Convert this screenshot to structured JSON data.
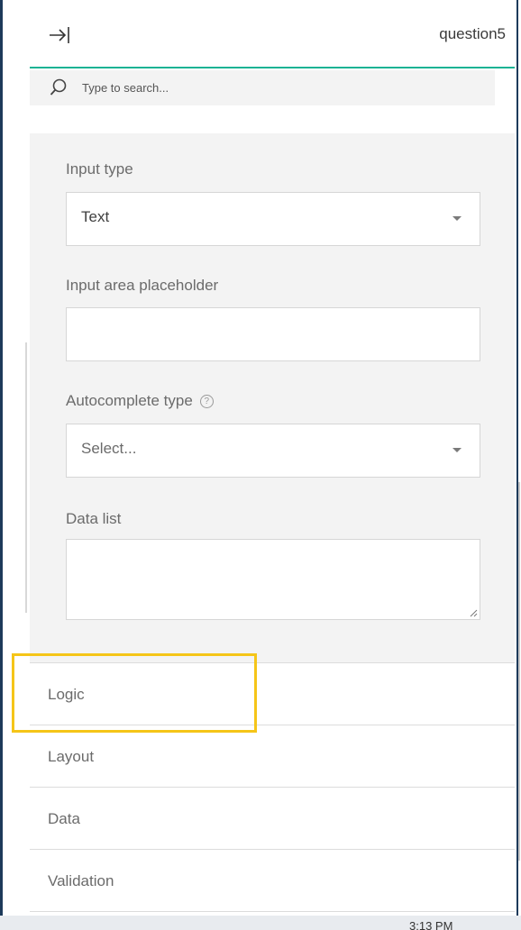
{
  "header": {
    "title": "question5",
    "collapse_icon": "collapse-to-right-icon"
  },
  "search": {
    "placeholder": "Type to search...",
    "icon": "search-icon"
  },
  "properties": {
    "input_type": {
      "label": "Input type",
      "value": "Text"
    },
    "placeholder_field": {
      "label": "Input area placeholder",
      "value": ""
    },
    "autocomplete": {
      "label": "Autocomplete type",
      "value": "Select...",
      "help_icon": "?"
    },
    "data_list": {
      "label": "Data list",
      "value": ""
    }
  },
  "sections": [
    {
      "label": "Logic",
      "highlighted": true
    },
    {
      "label": "Layout"
    },
    {
      "label": "Data"
    },
    {
      "label": "Validation"
    }
  ],
  "taskbar": {
    "time": "3:13 PM"
  },
  "colors": {
    "accent": "#19b394",
    "highlight": "#f5c518",
    "panel_bg": "#f3f3f3",
    "frame": "#1d3a5a"
  }
}
